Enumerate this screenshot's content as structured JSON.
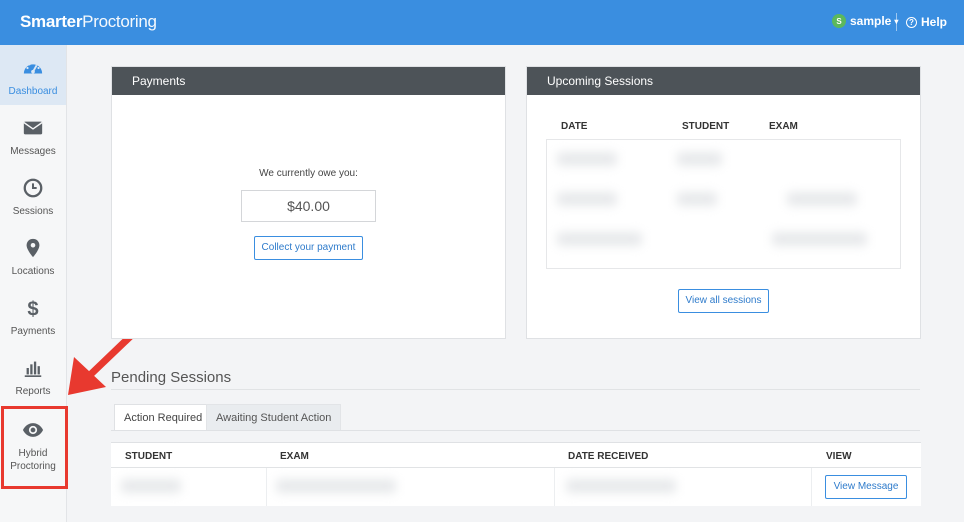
{
  "app": {
    "logo_prefix": "Smarter",
    "logo_suffix": "Proctoring",
    "user_initial": "S",
    "user_name": "sample",
    "help_label": "Help"
  },
  "colors": {
    "topbar": "#3a8ee0",
    "accent": "#3a8ee0",
    "panel_header": "#4d5358",
    "highlight": "#e8392f"
  },
  "sidebar": {
    "items": [
      {
        "label": "Dashboard",
        "icon": "speedometer-icon",
        "active": true
      },
      {
        "label": "Messages",
        "icon": "envelope-icon"
      },
      {
        "label": "Sessions",
        "icon": "clock-icon"
      },
      {
        "label": "Locations",
        "icon": "map-pin-icon"
      },
      {
        "label": "Payments",
        "icon": "dollar-icon"
      },
      {
        "label": "Reports",
        "icon": "bar-chart-icon"
      },
      {
        "label": "Hybrid Proctoring",
        "icon": "eye-icon"
      }
    ]
  },
  "payments": {
    "title": "Payments",
    "owe_label": "We currently owe you:",
    "amount": "$40.00",
    "collect_button": "Collect your payment"
  },
  "upcoming": {
    "title": "Upcoming Sessions",
    "columns": [
      "DATE",
      "STUDENT",
      "EXAM"
    ],
    "view_all_button": "View all sessions"
  },
  "pending": {
    "title": "Pending Sessions",
    "tabs": [
      "Action Required",
      "Awaiting Student Action"
    ],
    "columns": [
      "STUDENT",
      "EXAM",
      "DATE RECEIVED",
      "VIEW"
    ],
    "view_message_button": "View Message"
  }
}
